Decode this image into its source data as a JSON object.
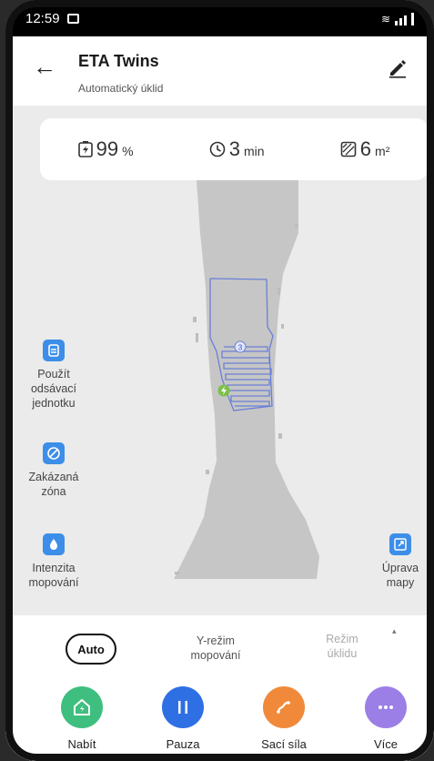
{
  "status_bar": {
    "time": "12:59"
  },
  "header": {
    "title": "ETA Twins",
    "subtitle": "Automatický úklid"
  },
  "stats": {
    "battery": {
      "value": "99",
      "unit": "%"
    },
    "time": {
      "value": "3",
      "unit": "min"
    },
    "area": {
      "value": "6",
      "unit": "m²"
    }
  },
  "map": {
    "room_label": "3"
  },
  "left_tools": [
    {
      "label_lines": [
        "Použít",
        "odsávací",
        "jednotku"
      ]
    },
    {
      "label_lines": [
        "Zakázaná",
        "zóna"
      ]
    },
    {
      "label_lines": [
        "Intenzita",
        "mopování"
      ]
    }
  ],
  "right_tool": {
    "label_lines": [
      "Úprava",
      "mapy"
    ]
  },
  "modes": {
    "auto": "Auto",
    "y_mode": [
      "Y-režim",
      "mopování"
    ],
    "clean_mode": [
      "Režim",
      "úklidu"
    ],
    "caret": "▴"
  },
  "actions": [
    {
      "label": "Nabít",
      "color": "#3fbf7f",
      "icon": "home-charge-icon"
    },
    {
      "label": "Pauza",
      "color": "#2f6fe4",
      "icon": "pause-icon"
    },
    {
      "label": "Sací síla",
      "color": "#f08a3a",
      "icon": "suction-icon"
    },
    {
      "label": "Více",
      "color": "#9b7fe6",
      "icon": "more-icon"
    }
  ],
  "colors": {
    "accent": "#3d8ee8",
    "map_floor": "#c6c6c6",
    "map_background": "#ebebeb",
    "path": "#6a7fd6"
  }
}
